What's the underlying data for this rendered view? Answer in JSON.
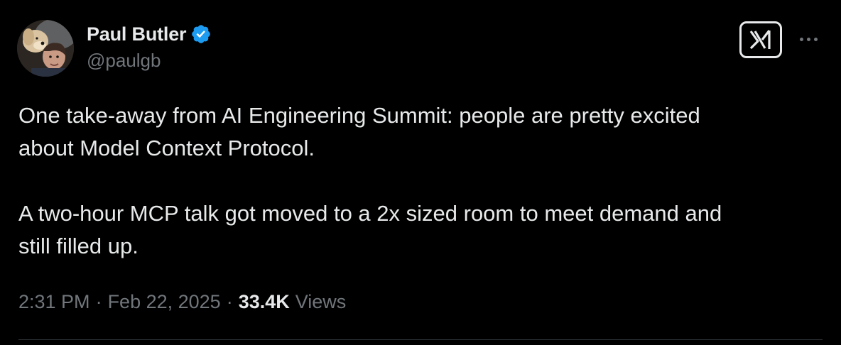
{
  "author": {
    "display_name": "Paul Butler",
    "handle": "@paulgb",
    "verified": true,
    "verified_color": "#1d9bf0",
    "avatar_icon": "profile-photo"
  },
  "actions": {
    "grok_icon": "grok-icon",
    "more_icon": "more-options-icon"
  },
  "tweet": {
    "paragraphs": [
      "One take-away from AI Engineering Summit: people are pretty excited\nabout Model Context Protocol.",
      "A two-hour MCP talk got moved to a 2x sized room to meet demand and\nstill filled up."
    ]
  },
  "meta": {
    "time": "2:31 PM",
    "separator": "·",
    "date": "Feb 22, 2025",
    "views_count": "33.4K",
    "views_label": "Views"
  },
  "colors": {
    "background": "#000000",
    "text": "#e7e9ea",
    "secondary": "#71767b",
    "divider": "#2f3336"
  }
}
